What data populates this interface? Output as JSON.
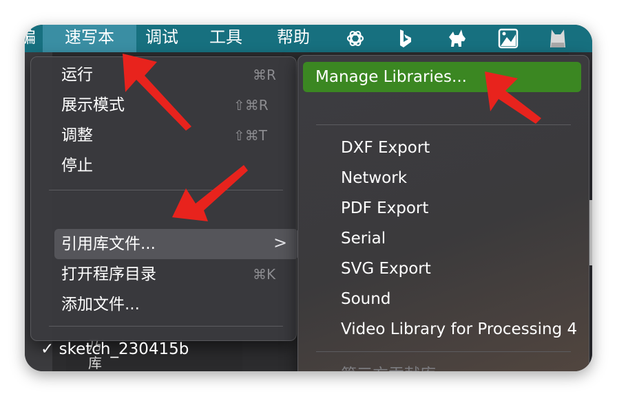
{
  "menubar": {
    "partial_left": "编辑",
    "items": [
      "速写本",
      "调试",
      "工具",
      "帮助"
    ],
    "icons": [
      "openai-icon",
      "bing-icon",
      "dog-icon",
      "image-icon",
      "cat-icon"
    ]
  },
  "sketch_menu": {
    "items": [
      {
        "label": "运行",
        "shortcut": "⌘R"
      },
      {
        "label": "展示模式",
        "shortcut": "⇧⌘R"
      },
      {
        "label": "调整",
        "shortcut": "⇧⌘T"
      },
      {
        "label": "停止",
        "shortcut": ""
      },
      {
        "label": "引用库文件...",
        "submenu": ">"
      },
      {
        "label": "打开程序目录",
        "shortcut": "⌘K"
      },
      {
        "label": "添加文件..."
      },
      {
        "check": "✓",
        "label": "sketch_230415b"
      }
    ]
  },
  "libraries_submenu": {
    "manage": "Manage Libraries...",
    "items": [
      "DXF Export",
      "Network",
      "PDF Export",
      "Serial",
      "SVG Export",
      "Sound",
      "Video Library for Processing 4"
    ],
    "section_header": "第三方贡献库"
  },
  "background": {
    "left_label_1": "乃",
    "left_label_2": "库"
  },
  "colors": {
    "menubar": "#17707f",
    "highlight_green": "#3b8722",
    "annotation_arrow": "#e8231d"
  }
}
